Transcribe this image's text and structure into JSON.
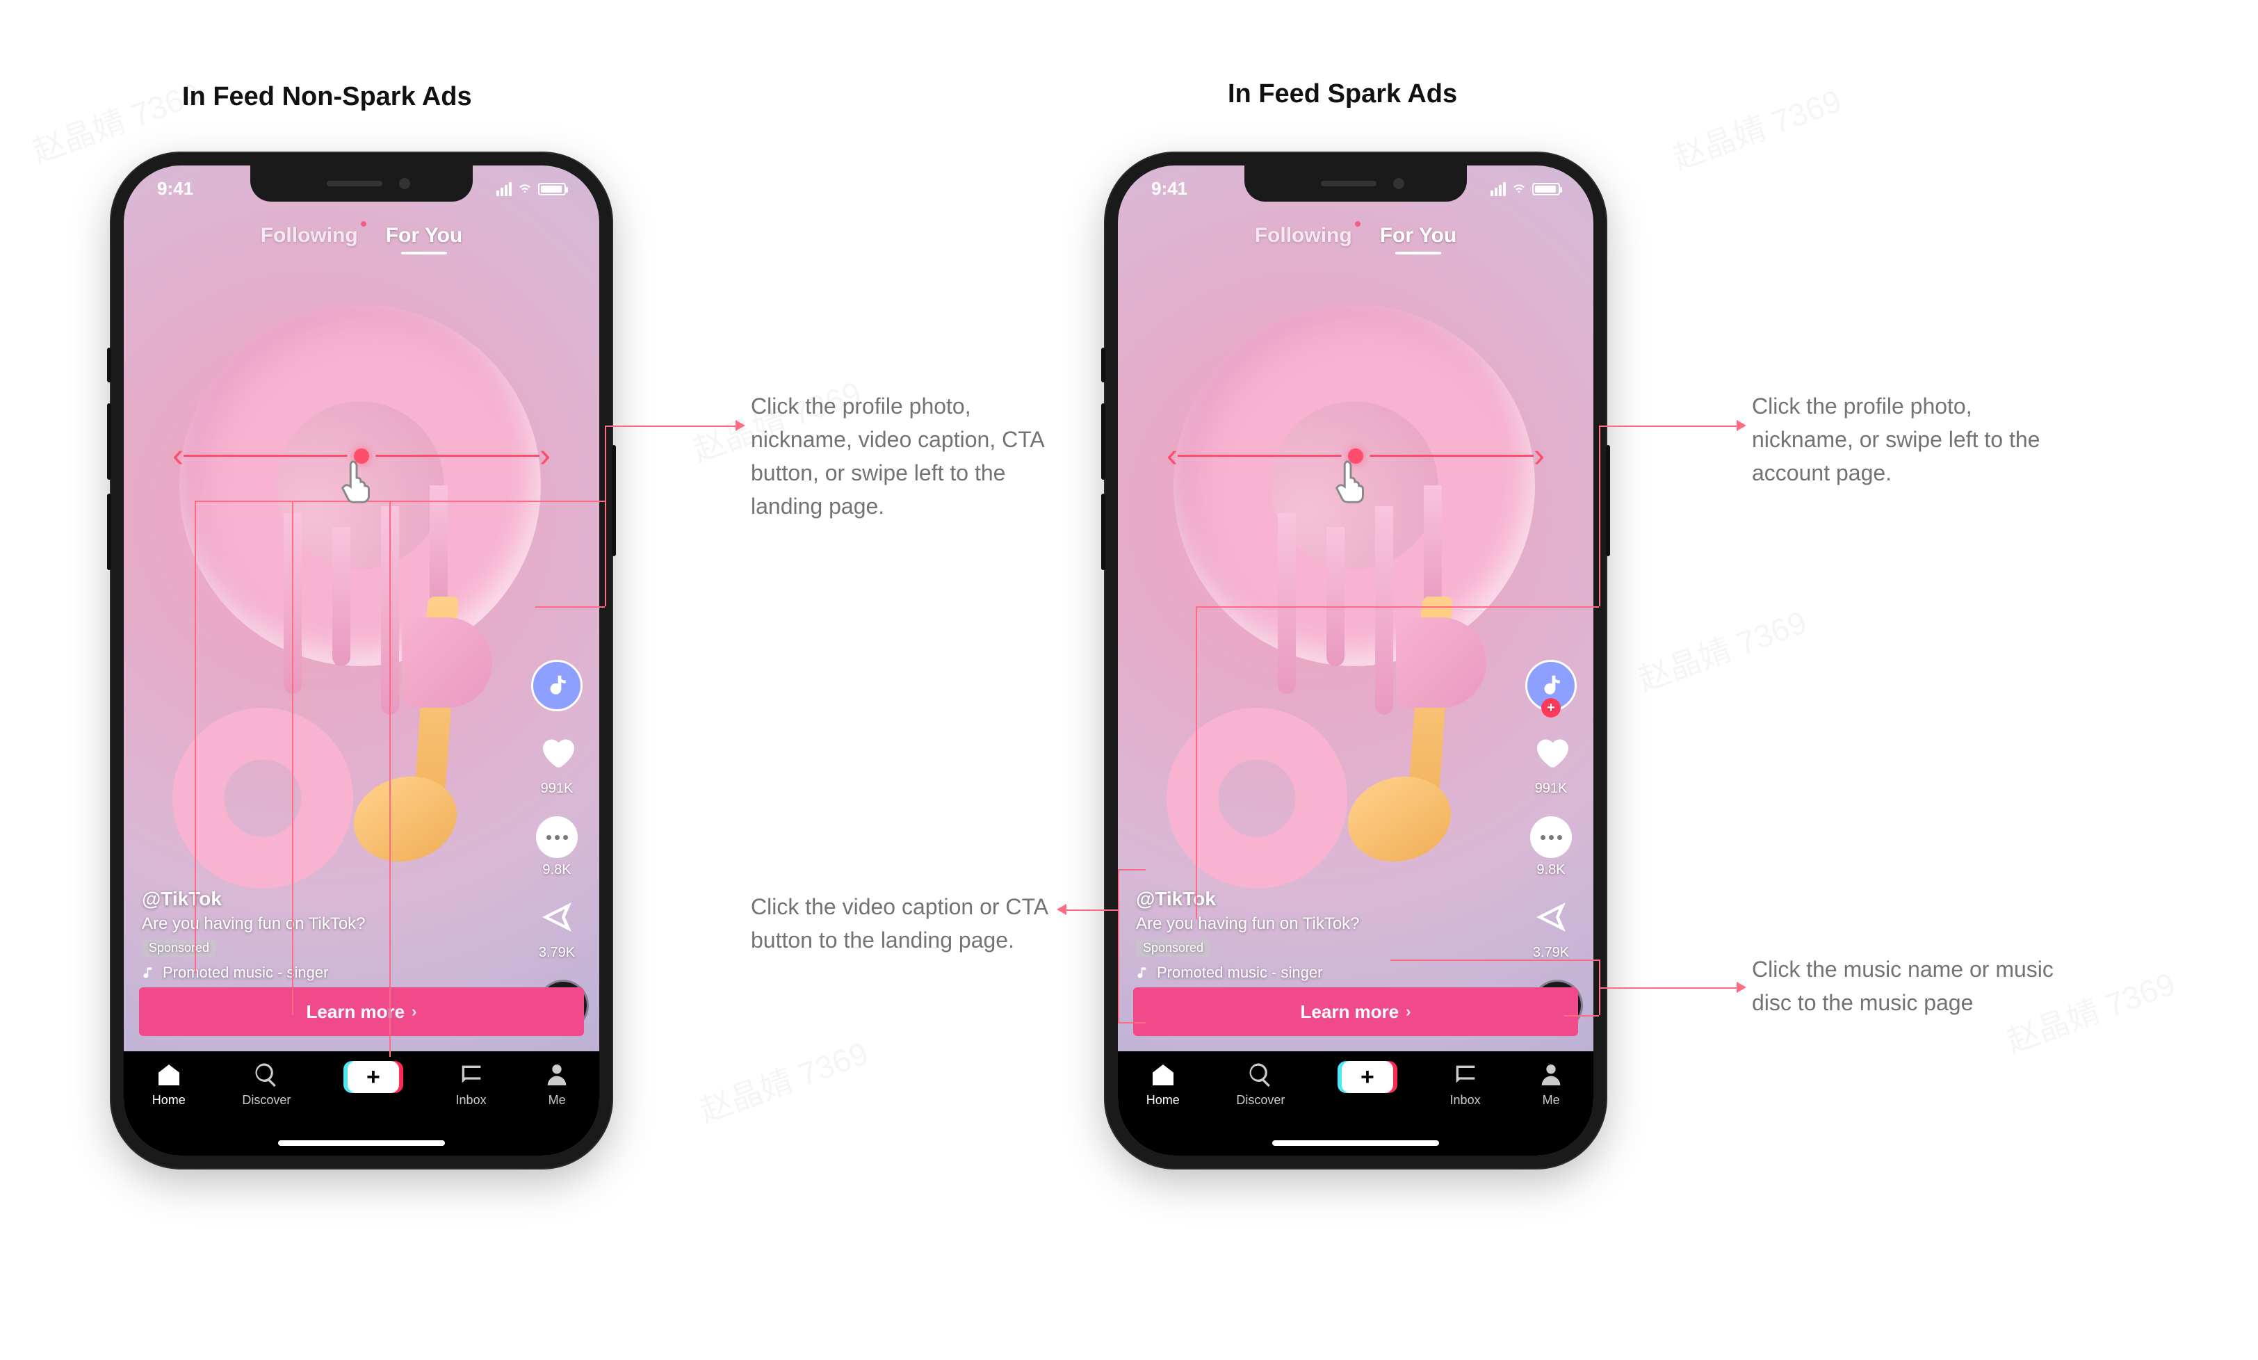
{
  "watermark": "赵晶婧 7369",
  "headings": {
    "nonspark": "In Feed Non-Spark Ads",
    "spark": "In Feed Spark Ads"
  },
  "phone": {
    "time": "9:41",
    "tabs": {
      "following": "Following",
      "foryou": "For You"
    },
    "likes": "991K",
    "comments": "9.8K",
    "shares": "3.79K",
    "nickname": "@TikTok",
    "caption": "Are you having fun on TikTok?",
    "sponsor": "Sponsored",
    "music": "Promoted music - singer",
    "cta": "Learn more",
    "cta_chevron": "›",
    "nav": {
      "home": "Home",
      "discover": "Discover",
      "inbox": "Inbox",
      "me": "Me"
    }
  },
  "annotations": {
    "nonspark_top": "Click the profile photo, nickname, video caption, CTA button, or swipe left to the landing page.",
    "spark_top": "Click the profile photo, nickname, or swipe left to the account page.",
    "spark_mid": "Click the video caption or CTA button to the landing page.",
    "spark_music": "Click the music name or music disc to the music page"
  }
}
